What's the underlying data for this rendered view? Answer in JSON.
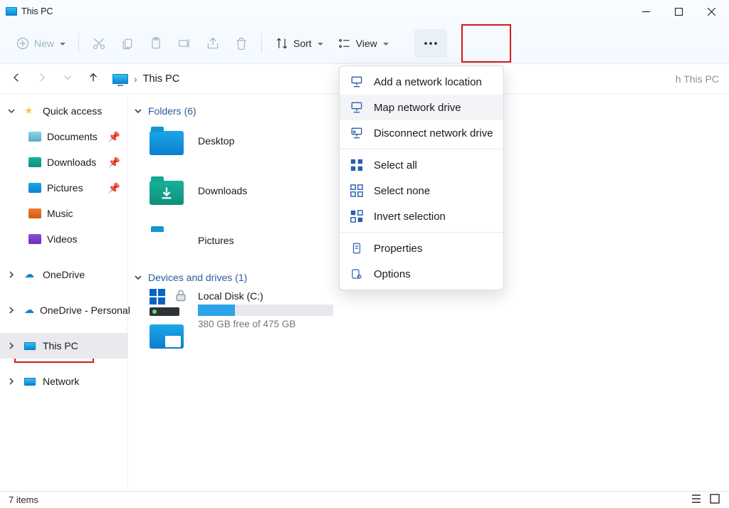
{
  "window": {
    "title": "This PC"
  },
  "toolbar": {
    "new_label": "New",
    "sort_label": "Sort",
    "view_label": "View"
  },
  "address": {
    "crumb": "This PC"
  },
  "search": {
    "placeholder": "Search This PC"
  },
  "sidebar": {
    "quick_access": "Quick access",
    "items": [
      {
        "label": "Documents"
      },
      {
        "label": "Downloads"
      },
      {
        "label": "Pictures"
      },
      {
        "label": "Music"
      },
      {
        "label": "Videos"
      }
    ],
    "onedrive": "OneDrive",
    "onedrive_personal": "OneDrive - Personal",
    "this_pc": "This PC",
    "network": "Network"
  },
  "sections": {
    "folders_label": "Folders (6)",
    "drives_label": "Devices and drives (1)"
  },
  "folders": [
    {
      "label": "Desktop"
    },
    {
      "label": "Downloads"
    },
    {
      "label": "Pictures"
    }
  ],
  "drive": {
    "name": "Local Disk (C:)",
    "free_text": "380 GB free of 475 GB"
  },
  "menu": {
    "add_location": "Add a network location",
    "map_drive": "Map network drive",
    "disconnect": "Disconnect network drive",
    "select_all": "Select all",
    "select_none": "Select none",
    "invert": "Invert selection",
    "properties": "Properties",
    "options": "Options"
  },
  "status": {
    "items": "7 items"
  },
  "colors": {
    "accent": "#0b63c6",
    "folder_blue_a": "#1aa8e8",
    "folder_blue_b": "#0b7ed0",
    "folder_teal_a": "#17b29a",
    "folder_teal_b": "#0f8f7b",
    "highlight_red": "#d11a1a"
  }
}
